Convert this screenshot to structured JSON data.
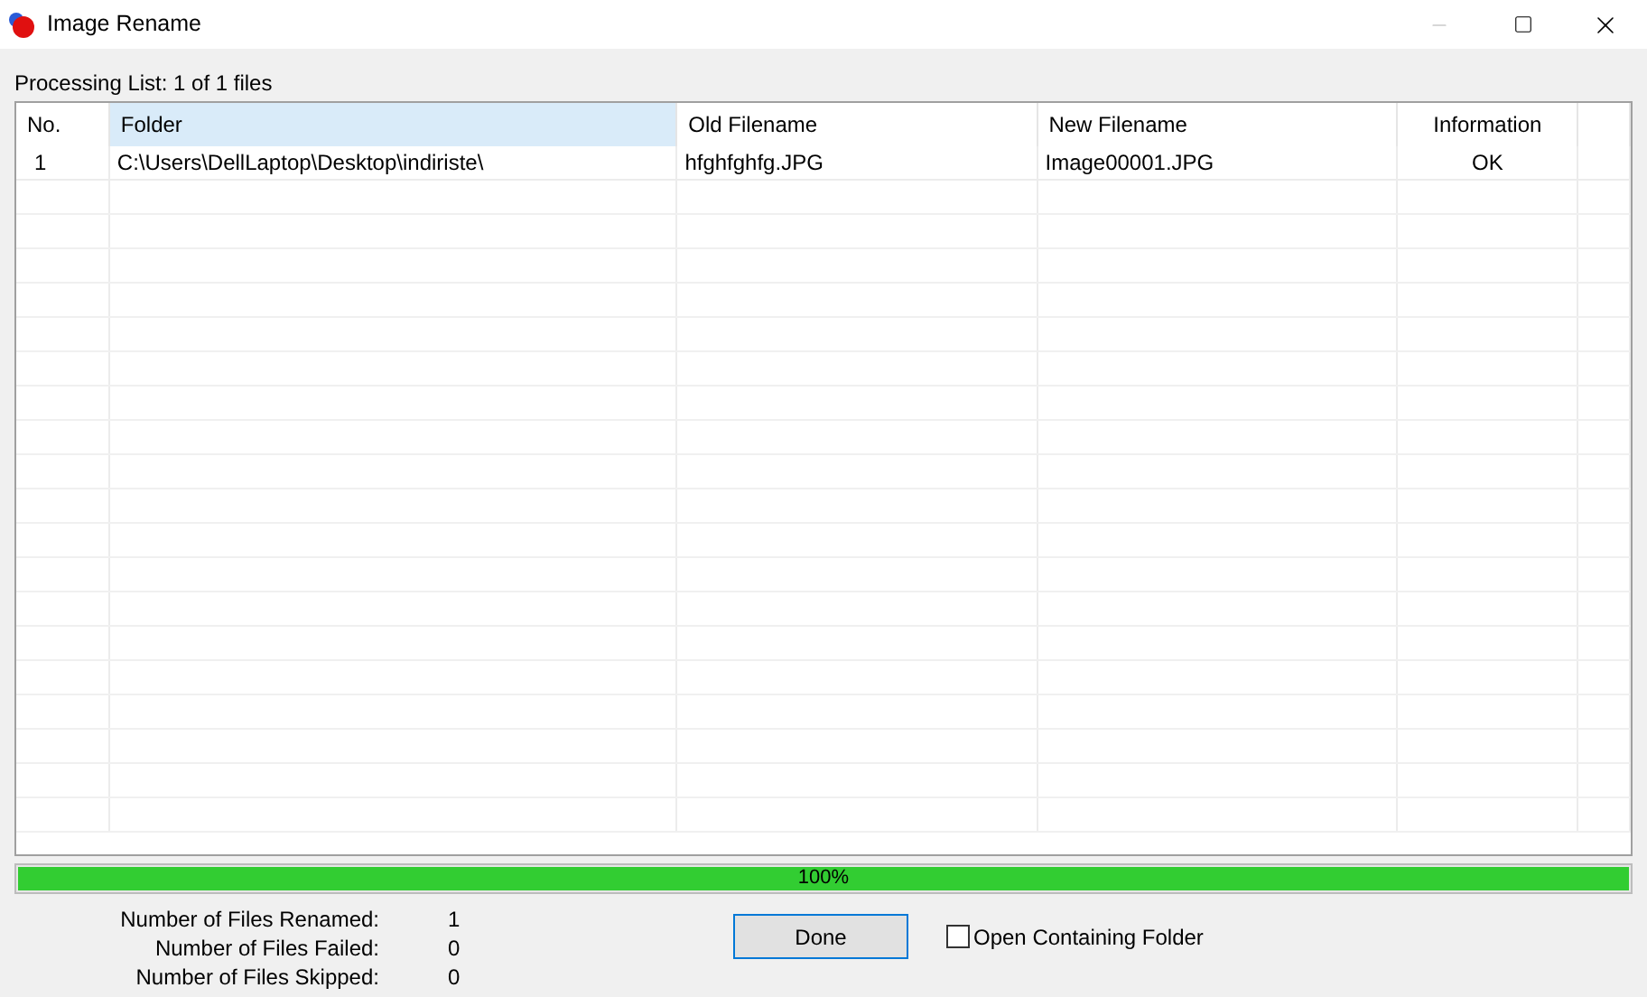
{
  "window": {
    "title": "Image Rename",
    "minimize_disabled": true
  },
  "processing_label": "Processing List: 1 of 1 files",
  "table": {
    "columns": [
      {
        "label": "No.",
        "selected": false
      },
      {
        "label": "Folder",
        "selected": true
      },
      {
        "label": "Old Filename",
        "selected": false
      },
      {
        "label": "New Filename",
        "selected": false
      },
      {
        "label": "Information",
        "selected": false
      }
    ],
    "rows": [
      {
        "cells": [
          "1",
          "C:\\Users\\DellLaptop\\Desktop\\indiriste\\",
          "hfghfghfg.JPG",
          "Image00001.JPG",
          "OK"
        ]
      }
    ]
  },
  "progress": {
    "level": 1,
    "reading": "100%"
  },
  "stats": [
    {
      "label": "Number of Files Renamed:",
      "value": "1"
    },
    {
      "label": "Number of Files Failed:",
      "value": "0"
    },
    {
      "label": "Number of Files Skipped:",
      "value": "0"
    }
  ],
  "done_button": "Done",
  "open_folder": {
    "label": "Open Containing Folder",
    "checked": false
  }
}
